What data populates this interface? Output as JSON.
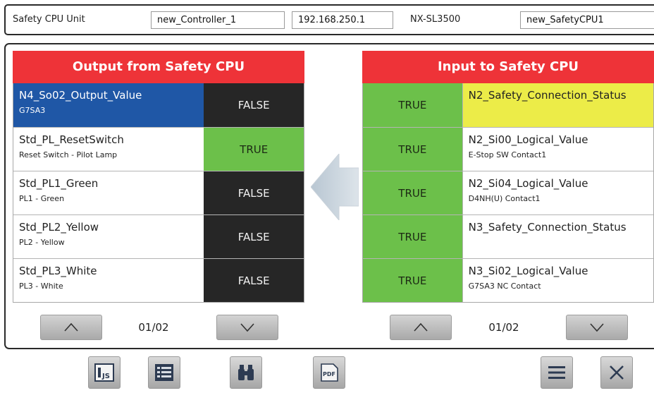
{
  "header": {
    "label": "Safety CPU Unit",
    "controller": "new_Controller_1",
    "ip": "192.168.250.1",
    "model": "NX-SL3500",
    "cpu_name": "new_SafetyCPU1"
  },
  "output_panel": {
    "title": "Output from Safety CPU",
    "rows": [
      {
        "name": "N4_So02_Output_Value",
        "desc": "G7SA3",
        "value": "FALSE",
        "selected": true
      },
      {
        "name": "Std_PL_ResetSwitch",
        "desc": "Reset Switch - Pilot Lamp",
        "value": "TRUE"
      },
      {
        "name": "Std_PL1_Green",
        "desc": "PL1 - Green",
        "value": "FALSE"
      },
      {
        "name": "Std_PL2_Yellow",
        "desc": "PL2 - Yellow",
        "value": "FALSE"
      },
      {
        "name": "Std_PL3_White",
        "desc": "PL3 - White",
        "value": "FALSE"
      }
    ],
    "page": "01/02"
  },
  "input_panel": {
    "title": "Input to Safety CPU",
    "rows": [
      {
        "name": "N2_Safety_Connection_Status",
        "desc": "",
        "value": "TRUE",
        "highlight": true
      },
      {
        "name": "N2_Si00_Logical_Value",
        "desc": "E-Stop SW Contact1",
        "value": "TRUE"
      },
      {
        "name": "N2_Si04_Logical_Value",
        "desc": "D4NH(U) Contact1",
        "value": "TRUE"
      },
      {
        "name": "N3_Safety_Connection_Status",
        "desc": "",
        "value": "TRUE"
      },
      {
        "name": "N3_Si02_Logical_Value",
        "desc": "G7SA3 NC Contact",
        "value": "TRUE"
      }
    ],
    "page": "01/02"
  },
  "toolbar": {
    "js_icon_text": "JS",
    "pdf_icon_text": "PDF"
  },
  "colors": {
    "title_red": "#ee3338",
    "true_green": "#6cc04a",
    "false_black": "#262626",
    "selected_blue": "#1f57a6",
    "highlight_yellow": "#ecec48"
  }
}
